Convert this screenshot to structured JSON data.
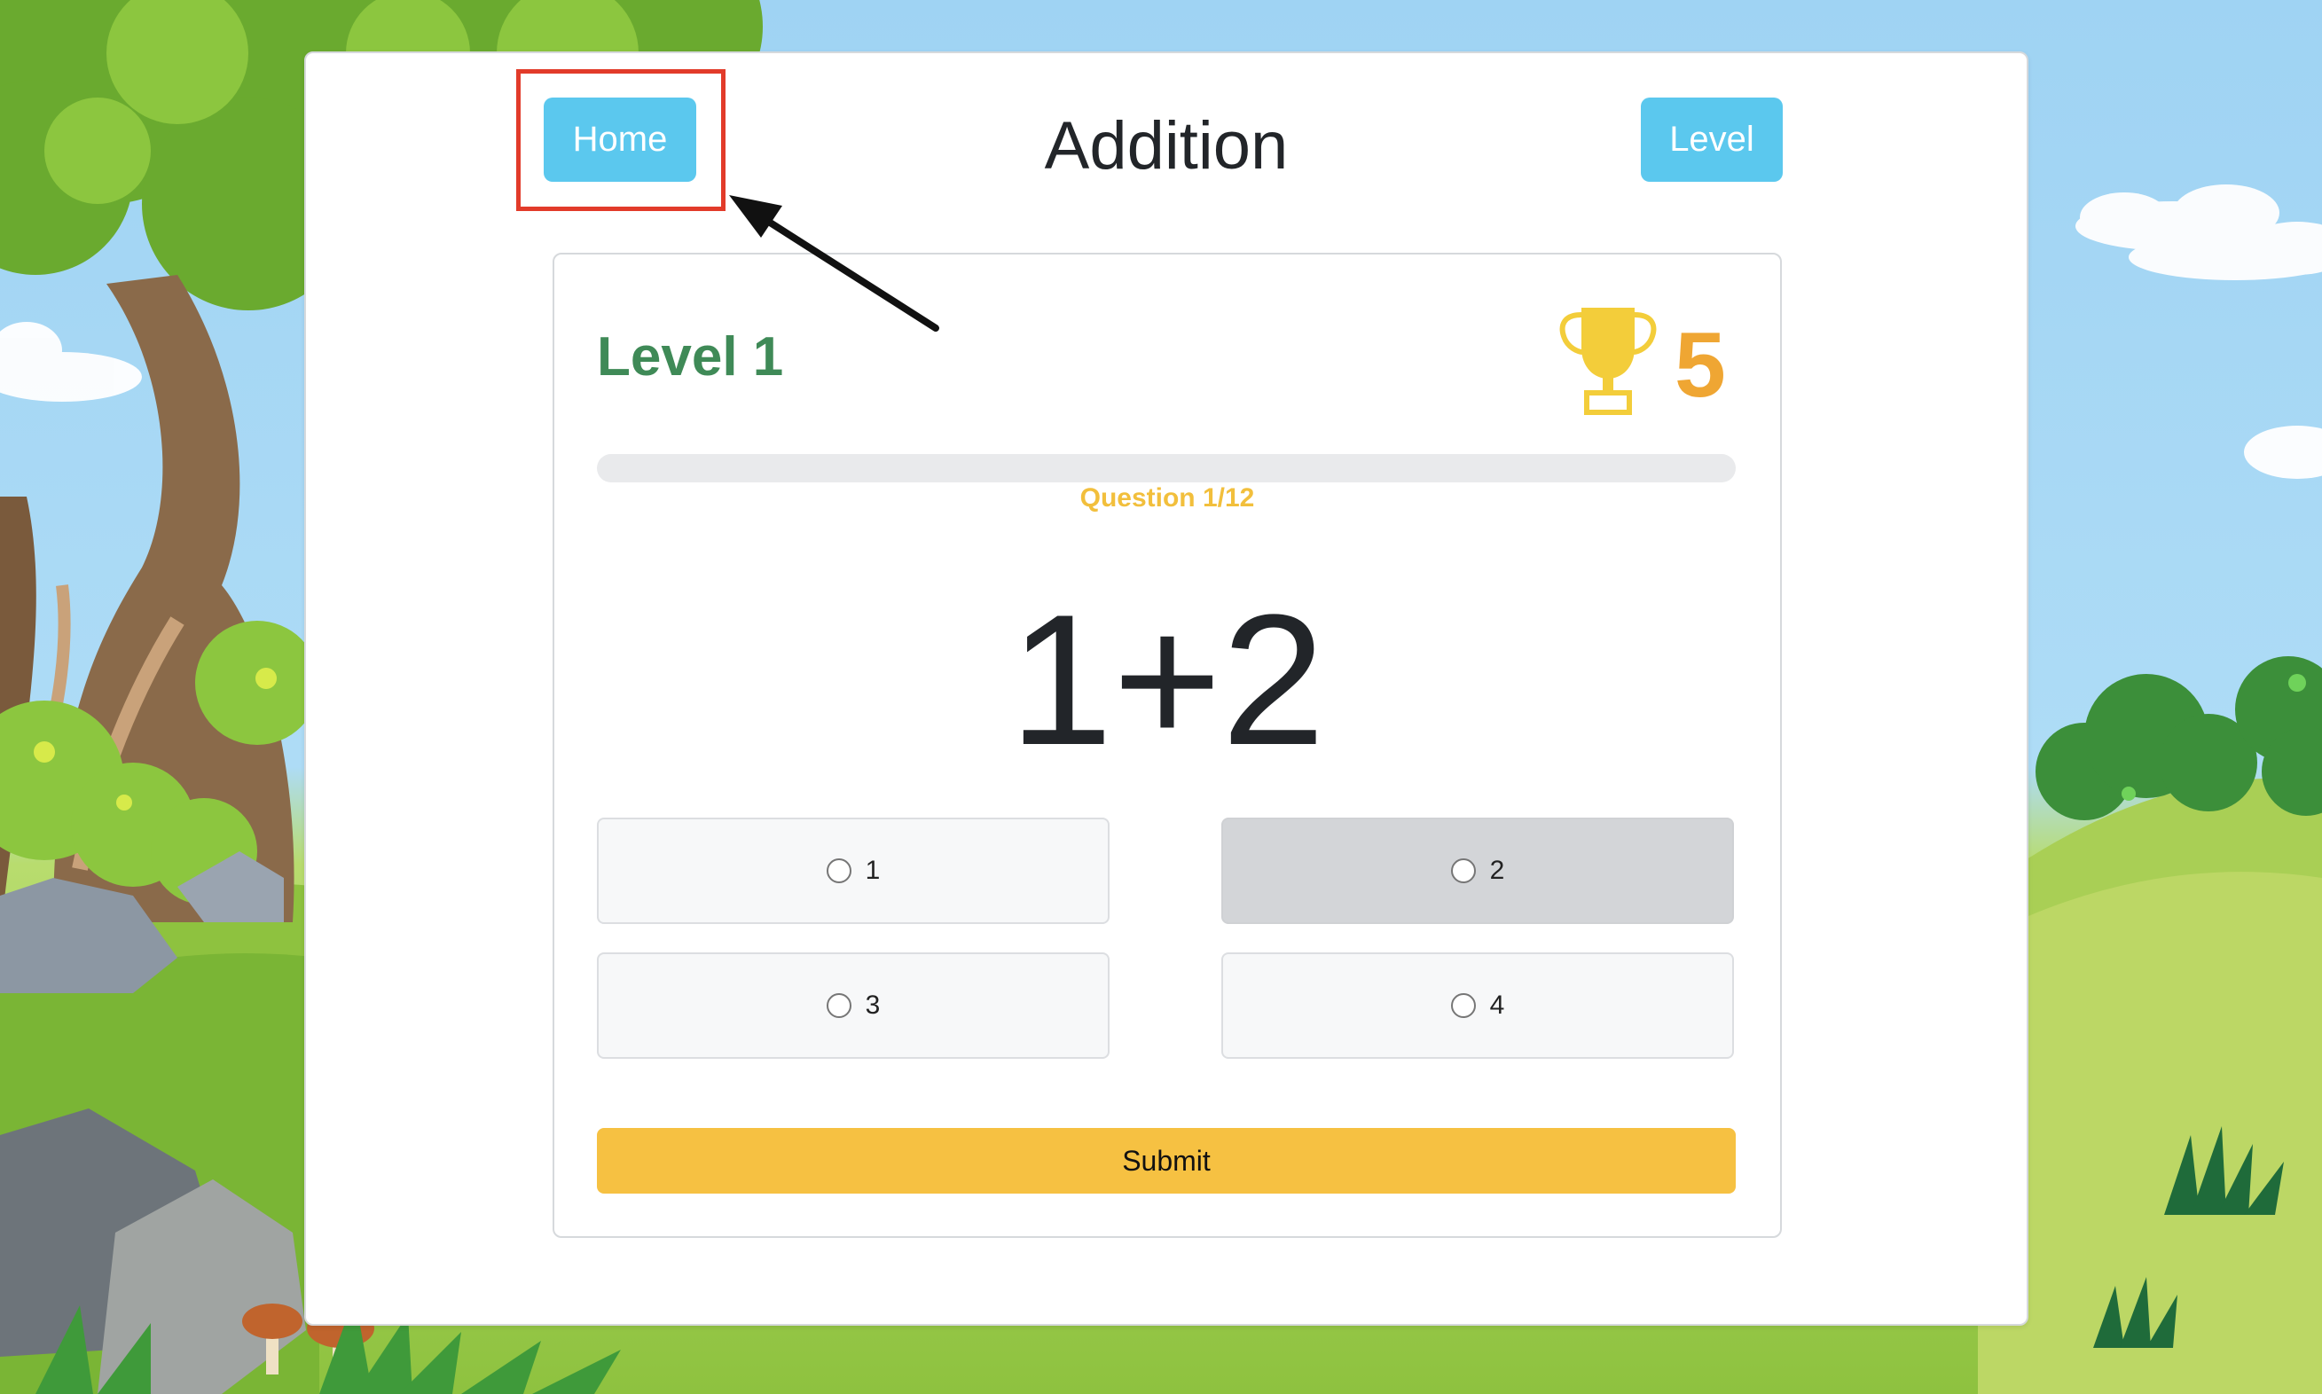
{
  "header": {
    "home_label": "Home",
    "title": "Addition",
    "level_label": "Level"
  },
  "quiz": {
    "level": "Level 1",
    "score": "5",
    "question_counter": "Question 1/12",
    "progress_fraction": 0.0,
    "problem": "1+2",
    "options": [
      "1",
      "2",
      "3",
      "4"
    ],
    "selected_option_hover": "2",
    "submit_label": "Submit"
  },
  "colors": {
    "button_blue": "#5bc8ee",
    "level_green": "#3f8a57",
    "score_orange": "#efa633",
    "submit_yellow": "#f6c142",
    "annotation_red": "#e23b2a"
  },
  "icons": {
    "trophy": "trophy-icon",
    "annotation_arrow": "arrow-icon"
  }
}
